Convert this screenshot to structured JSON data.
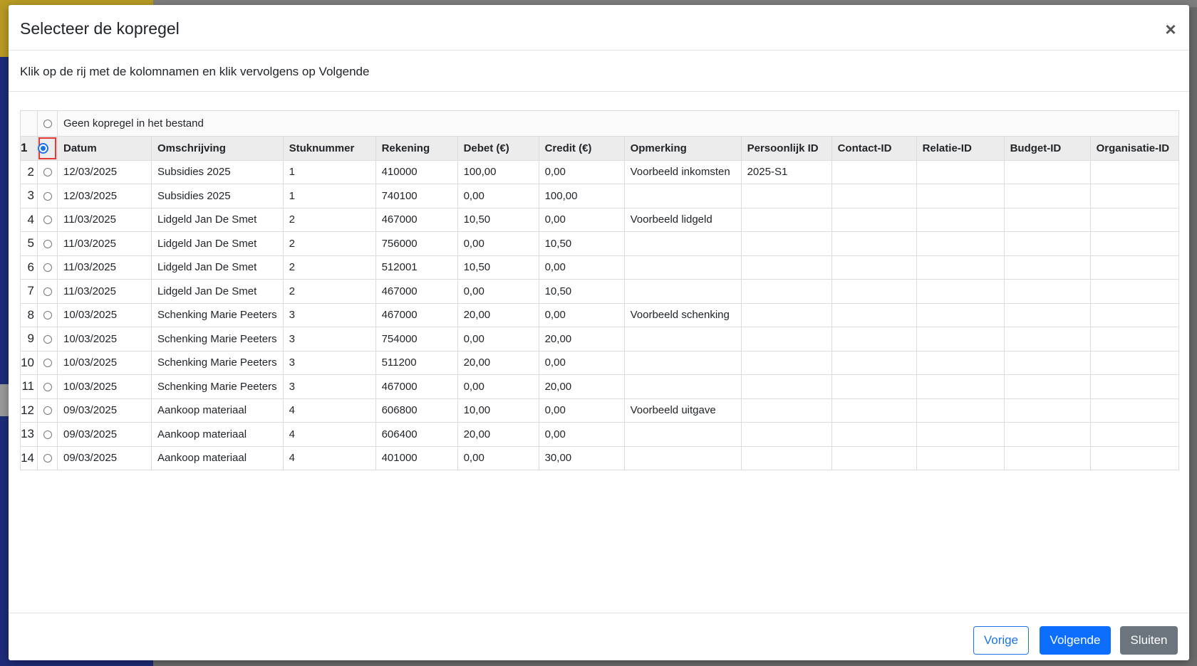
{
  "dialog": {
    "title": "Selecteer de kopregel",
    "close_glyph": "×",
    "instruction": "Klik op de rij met de kolomnamen en klik vervolgens op Volgende"
  },
  "table": {
    "no_header_label": "Geen kopregel in het bestand",
    "selected_row": 1,
    "columns": [
      "Datum",
      "Omschrijving",
      "Stuknummer",
      "Rekening",
      "Debet (€)",
      "Credit (€)",
      "Opmerking",
      "Persoonlijk ID",
      "Contact-ID",
      "Relatie-ID",
      "Budget-ID",
      "Organisatie-ID"
    ],
    "rows": [
      {
        "num": "2",
        "cells": [
          "12/03/2025",
          "Subsidies 2025",
          "1",
          "410000",
          "100,00",
          "0,00",
          "Voorbeeld inkomsten",
          "2025-S1",
          "",
          "",
          "",
          ""
        ]
      },
      {
        "num": "3",
        "cells": [
          "12/03/2025",
          "Subsidies 2025",
          "1",
          "740100",
          "0,00",
          "100,00",
          "",
          "",
          "",
          "",
          "",
          ""
        ]
      },
      {
        "num": "4",
        "cells": [
          "11/03/2025",
          "Lidgeld Jan De Smet",
          "2",
          "467000",
          "10,50",
          "0,00",
          "Voorbeeld lidgeld",
          "",
          "",
          "",
          "",
          ""
        ]
      },
      {
        "num": "5",
        "cells": [
          "11/03/2025",
          "Lidgeld Jan De Smet",
          "2",
          "756000",
          "0,00",
          "10,50",
          "",
          "",
          "",
          "",
          "",
          ""
        ]
      },
      {
        "num": "6",
        "cells": [
          "11/03/2025",
          "Lidgeld Jan De Smet",
          "2",
          "512001",
          "10,50",
          "0,00",
          "",
          "",
          "",
          "",
          "",
          ""
        ]
      },
      {
        "num": "7",
        "cells": [
          "11/03/2025",
          "Lidgeld Jan De Smet",
          "2",
          "467000",
          "0,00",
          "10,50",
          "",
          "",
          "",
          "",
          "",
          ""
        ]
      },
      {
        "num": "8",
        "cells": [
          "10/03/2025",
          "Schenking Marie Peeters",
          "3",
          "467000",
          "20,00",
          "0,00",
          "Voorbeeld schenking",
          "",
          "",
          "",
          "",
          ""
        ]
      },
      {
        "num": "9",
        "cells": [
          "10/03/2025",
          "Schenking Marie Peeters",
          "3",
          "754000",
          "0,00",
          "20,00",
          "",
          "",
          "",
          "",
          "",
          ""
        ]
      },
      {
        "num": "10",
        "cells": [
          "10/03/2025",
          "Schenking Marie Peeters",
          "3",
          "511200",
          "20,00",
          "0,00",
          "",
          "",
          "",
          "",
          "",
          ""
        ]
      },
      {
        "num": "11",
        "cells": [
          "10/03/2025",
          "Schenking Marie Peeters",
          "3",
          "467000",
          "0,00",
          "20,00",
          "",
          "",
          "",
          "",
          "",
          ""
        ]
      },
      {
        "num": "12",
        "cells": [
          "09/03/2025",
          "Aankoop materiaal",
          "4",
          "606800",
          "10,00",
          "0,00",
          "Voorbeeld uitgave",
          "",
          "",
          "",
          "",
          ""
        ]
      },
      {
        "num": "13",
        "cells": [
          "09/03/2025",
          "Aankoop materiaal",
          "4",
          "606400",
          "20,00",
          "0,00",
          "",
          "",
          "",
          "",
          "",
          ""
        ]
      },
      {
        "num": "14",
        "cells": [
          "09/03/2025",
          "Aankoop materiaal",
          "4",
          "401000",
          "0,00",
          "30,00",
          "",
          "",
          "",
          "",
          "",
          ""
        ]
      }
    ]
  },
  "footer": {
    "prev_label": "Vorige",
    "next_label": "Volgende",
    "close_label": "Sluiten"
  },
  "colors": {
    "primary": "#0d6efd",
    "secondary": "#6c757d",
    "highlight": "#e53935"
  },
  "icons": {
    "close": "close-icon",
    "radio_selected": "radio-selected-icon",
    "radio": "radio-icon"
  }
}
